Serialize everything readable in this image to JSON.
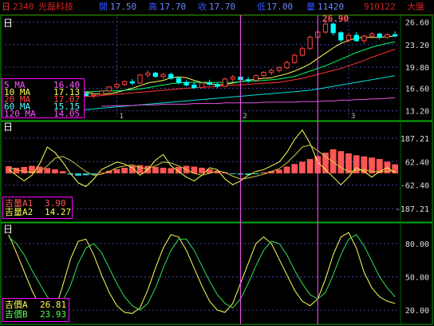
{
  "header": {
    "stock_code": "2340",
    "stock_name": "光磊科技",
    "open": "17.50",
    "high": "17.70",
    "close": "17.70",
    "low": "17.00",
    "volume": "11420",
    "date": "910122",
    "period": "日",
    "icon_open": "開",
    "icon_high": "高",
    "icon_close": "收",
    "icon_low": "低",
    "icon_volume": "量",
    "mode": "大盤"
  },
  "panels": {
    "price": {
      "label": "日",
      "ma_legend": [
        {
          "name": "5 MA",
          "value": "16.40",
          "color": "#ff55ff"
        },
        {
          "name": "10 MA",
          "value": "17.13",
          "color": "#ffff55"
        },
        {
          "name": "20 MA",
          "value": "17.07",
          "color": "#ff4444"
        },
        {
          "name": "60 MA",
          "value": "15.15",
          "color": "#55ffff"
        },
        {
          "name": "120 MA",
          "value": "14.05",
          "color": "#ff55ff"
        }
      ],
      "max_marker": "26.90",
      "month_labels": [
        "1",
        "2",
        "3"
      ]
    },
    "macd": {
      "label": "日",
      "legend": [
        {
          "name": "吉量A1",
          "value": "3.90",
          "color": "#ff5555"
        },
        {
          "name": "吉量A2",
          "value": "14.27",
          "color": "#ffff55"
        }
      ]
    },
    "kd": {
      "label": "日",
      "legend": [
        {
          "name": "吉價A",
          "value": "26.81",
          "color": "#ffff55"
        },
        {
          "name": "吉價B",
          "value": "23.93",
          "color": "#55ff55"
        }
      ]
    }
  },
  "colors": {
    "up": "#ff4444",
    "down": "#00ffff",
    "grid": "#4444aa",
    "border": "#00aa00",
    "marker": "#ff55ff"
  },
  "chart_data": [
    {
      "type": "candlestick",
      "yticks": [
        13.2,
        16.6,
        19.8,
        23.2,
        26.6
      ],
      "ylim": [
        12.2,
        27.4
      ],
      "candles": [
        [
          14.6,
          15.2,
          14.4,
          15.0
        ],
        [
          15.0,
          15.6,
          14.8,
          15.4
        ],
        [
          15.4,
          15.5,
          14.9,
          15.0
        ],
        [
          15.0,
          15.8,
          14.9,
          15.6
        ],
        [
          15.6,
          17.3,
          15.5,
          17.1
        ],
        [
          17.1,
          17.6,
          16.7,
          16.9
        ],
        [
          16.9,
          17.2,
          16.3,
          16.5
        ],
        [
          16.5,
          16.7,
          15.8,
          16.0
        ],
        [
          16.0,
          16.3,
          15.4,
          15.6
        ],
        [
          15.6,
          15.9,
          15.2,
          15.8
        ],
        [
          15.8,
          16.1,
          15.4,
          15.5
        ],
        [
          15.5,
          15.9,
          15.1,
          15.7
        ],
        [
          15.7,
          16.3,
          15.6,
          16.2
        ],
        [
          16.2,
          16.9,
          16.0,
          16.8
        ],
        [
          16.8,
          17.4,
          16.6,
          17.2
        ],
        [
          17.2,
          17.8,
          16.9,
          17.6
        ],
        [
          17.6,
          18.0,
          17.1,
          17.4
        ],
        [
          17.4,
          18.8,
          17.3,
          18.6
        ],
        [
          18.6,
          19.3,
          18.2,
          18.9
        ],
        [
          18.9,
          19.1,
          18.2,
          18.4
        ],
        [
          18.4,
          18.9,
          18.0,
          18.7
        ],
        [
          18.7,
          19.0,
          17.9,
          18.1
        ],
        [
          18.1,
          18.4,
          17.2,
          17.5
        ],
        [
          17.5,
          17.8,
          16.9,
          17.1
        ],
        [
          17.1,
          17.6,
          16.5,
          16.7
        ],
        [
          16.7,
          17.6,
          16.6,
          17.4
        ],
        [
          17.4,
          17.9,
          17.0,
          17.2
        ],
        [
          17.2,
          17.4,
          16.6,
          16.9
        ],
        [
          16.9,
          18.2,
          16.8,
          18.0
        ],
        [
          18.0,
          18.6,
          17.5,
          18.3
        ],
        [
          18.3,
          18.6,
          17.6,
          17.9
        ],
        [
          17.9,
          18.3,
          17.4,
          17.8
        ],
        [
          17.8,
          18.7,
          17.6,
          18.5
        ],
        [
          18.5,
          19.2,
          18.3,
          19.0
        ],
        [
          19.0,
          19.6,
          18.6,
          19.3
        ],
        [
          19.3,
          19.9,
          19.0,
          19.7
        ],
        [
          19.7,
          20.8,
          19.5,
          20.5
        ],
        [
          20.5,
          21.8,
          20.3,
          21.6
        ],
        [
          21.6,
          22.9,
          21.4,
          22.6
        ],
        [
          22.6,
          24.6,
          22.4,
          24.3
        ],
        [
          24.3,
          25.4,
          23.8,
          25.1
        ],
        [
          25.1,
          26.9,
          24.8,
          26.3
        ],
        [
          26.3,
          26.5,
          24.6,
          25.0
        ],
        [
          25.0,
          25.2,
          23.6,
          23.9
        ],
        [
          23.9,
          24.9,
          23.6,
          24.6
        ],
        [
          24.6,
          25.1,
          23.6,
          23.8
        ],
        [
          23.8,
          24.7,
          23.4,
          24.5
        ],
        [
          24.5,
          25.1,
          24.1,
          24.8
        ],
        [
          24.8,
          25.0,
          24.0,
          24.3
        ],
        [
          24.3,
          24.9,
          24.1,
          24.7
        ],
        [
          24.7,
          25.2,
          24.3,
          24.5
        ]
      ],
      "ma_series": [
        {
          "name": "5 MA",
          "color": "#ffff55",
          "values": [
            14.9,
            15.0,
            15.1,
            15.2,
            15.5,
            15.9,
            16.1,
            16.3,
            16.4,
            16.3,
            16.0,
            15.8,
            15.7,
            15.8,
            16.0,
            16.3,
            16.6,
            17.0,
            17.4,
            17.6,
            17.8,
            18.2,
            18.3,
            18.2,
            17.8,
            17.5,
            17.3,
            17.1,
            17.2,
            17.4,
            17.6,
            17.8,
            18.0,
            18.1,
            18.2,
            18.5,
            18.8,
            19.2,
            19.7,
            20.3,
            21.1,
            21.9,
            22.7,
            23.4,
            23.8,
            24.2,
            24.3,
            24.3,
            24.3,
            24.4,
            24.5
          ]
        },
        {
          "name": "10 MA",
          "color": "#00ff66",
          "values": [
            15.0,
            15.0,
            15.1,
            15.1,
            15.2,
            15.4,
            15.5,
            15.7,
            15.8,
            16.0,
            16.1,
            16.1,
            16.2,
            16.2,
            16.2,
            16.3,
            16.4,
            16.5,
            16.7,
            16.9,
            17.1,
            17.3,
            17.4,
            17.5,
            17.5,
            17.5,
            17.5,
            17.5,
            17.5,
            17.5,
            17.6,
            17.7,
            17.7,
            17.8,
            17.9,
            18.0,
            18.2,
            18.4,
            18.8,
            19.2,
            19.6,
            20.0,
            20.5,
            21.0,
            21.5,
            22.0,
            22.4,
            22.8,
            23.1,
            23.4,
            23.6
          ]
        },
        {
          "name": "20 MA",
          "color": "#ff3333",
          "values": [
            14.6,
            14.6,
            14.7,
            14.8,
            14.9,
            15.0,
            15.0,
            15.1,
            15.2,
            15.3,
            15.4,
            15.4,
            15.5,
            15.6,
            15.7,
            15.8,
            15.9,
            16.0,
            16.1,
            16.2,
            16.3,
            16.4,
            16.5,
            16.6,
            16.7,
            16.8,
            16.8,
            16.9,
            17.0,
            17.1,
            17.1,
            17.2,
            17.3,
            17.4,
            17.4,
            17.5,
            17.7,
            17.9,
            18.1,
            18.4,
            18.7,
            19.0,
            19.3,
            19.6,
            20.0,
            20.4,
            20.8,
            21.3,
            21.7,
            22.1,
            22.5
          ]
        },
        {
          "name": "60 MA",
          "color": "#00dddd",
          "values": [
            12.4,
            12.5,
            12.6,
            12.7,
            12.8,
            12.9,
            13.0,
            13.1,
            13.2,
            13.3,
            13.4,
            13.5,
            13.6,
            13.7,
            13.8,
            13.9,
            14.0,
            14.1,
            14.2,
            14.3,
            14.4,
            14.5,
            14.6,
            14.7,
            14.8,
            14.9,
            15.0,
            15.1,
            15.2,
            15.3,
            15.4,
            15.5,
            15.6,
            15.7,
            15.8,
            15.9,
            16.0,
            16.1,
            16.2,
            16.3,
            16.5,
            16.7,
            16.9,
            17.1,
            17.3,
            17.5,
            17.7,
            17.9,
            18.1,
            18.3,
            18.5
          ]
        },
        {
          "name": "120 MA",
          "color": "#dd55dd",
          "values": [
            null,
            null,
            null,
            null,
            null,
            null,
            null,
            null,
            null,
            null,
            null,
            null,
            13.9,
            13.9,
            14.0,
            14.0,
            14.0,
            14.1,
            14.1,
            14.1,
            14.2,
            14.2,
            14.2,
            14.2,
            14.3,
            14.3,
            14.3,
            14.3,
            14.4,
            14.4,
            14.4,
            14.4,
            14.4,
            14.5,
            14.5,
            14.5,
            14.5,
            14.5,
            14.6,
            14.6,
            14.6,
            14.7,
            14.7,
            14.8,
            14.8,
            14.9,
            14.9,
            15.0,
            15.0,
            15.1,
            15.2
          ]
        }
      ]
    },
    {
      "type": "bar",
      "yticks": [
        187.21,
        62.4,
        -62.4,
        -187.21
      ],
      "ylim": [
        -250,
        250
      ],
      "histogram": [
        38,
        30,
        34,
        40,
        36,
        28,
        22,
        12,
        -6,
        -12,
        -10,
        -6,
        4,
        14,
        22,
        30,
        40,
        44,
        40,
        34,
        30,
        28,
        34,
        40,
        36,
        30,
        22,
        12,
        6,
        -2,
        -6,
        -8,
        -4,
        6,
        12,
        20,
        36,
        50,
        62,
        76,
        92,
        110,
        128,
        118,
        106,
        96,
        90,
        84,
        76,
        62,
        48
      ],
      "series": [
        {
          "name": "吉量A1",
          "values": [
            20,
            -10,
            -40,
            -10,
            50,
            140,
            110,
            60,
            0,
            -50,
            -70,
            -30,
            20,
            40,
            60,
            50,
            30,
            -10,
            20,
            70,
            100,
            40,
            10,
            -20,
            -40,
            -10,
            30,
            20,
            -30,
            -60,
            -40,
            -10,
            10,
            20,
            40,
            60,
            110,
            180,
            230,
            160,
            60,
            20,
            -20,
            -60,
            -20,
            30,
            10,
            -20,
            10,
            30,
            4
          ]
        },
        {
          "name": "吉量A2",
          "values": [
            30,
            20,
            10,
            5,
            10,
            40,
            80,
            90,
            70,
            40,
            10,
            -10,
            -5,
            10,
            30,
            40,
            45,
            30,
            25,
            40,
            60,
            55,
            40,
            20,
            0,
            -10,
            0,
            15,
            5,
            -15,
            -30,
            -25,
            -15,
            -5,
            10,
            25,
            55,
            95,
            140,
            150,
            120,
            90,
            60,
            30,
            10,
            15,
            20,
            10,
            8,
            12,
            14
          ]
        }
      ]
    },
    {
      "type": "line",
      "yticks": [
        80.0,
        50.0,
        20.0
      ],
      "ylim": [
        10,
        95
      ],
      "series": [
        {
          "name": "吉價A",
          "values": [
            88,
            72,
            55,
            38,
            24,
            16,
            20,
            42,
            66,
            82,
            84,
            70,
            52,
            36,
            24,
            18,
            17,
            22,
            38,
            58,
            76,
            88,
            86,
            74,
            58,
            42,
            28,
            20,
            18,
            26,
            44,
            62,
            80,
            86,
            80,
            66,
            52,
            38,
            28,
            24,
            30,
            48,
            70,
            86,
            90,
            76,
            54,
            40,
            32,
            28,
            26
          ]
        },
        {
          "name": "吉價B",
          "values": [
            86,
            80,
            70,
            56,
            44,
            32,
            24,
            28,
            42,
            62,
            76,
            80,
            72,
            58,
            44,
            32,
            24,
            20,
            26,
            40,
            58,
            74,
            84,
            84,
            74,
            60,
            46,
            34,
            26,
            22,
            30,
            44,
            60,
            74,
            82,
            80,
            70,
            56,
            44,
            34,
            30,
            36,
            52,
            70,
            84,
            88,
            78,
            64,
            50,
            40,
            32
          ]
        }
      ]
    }
  ]
}
